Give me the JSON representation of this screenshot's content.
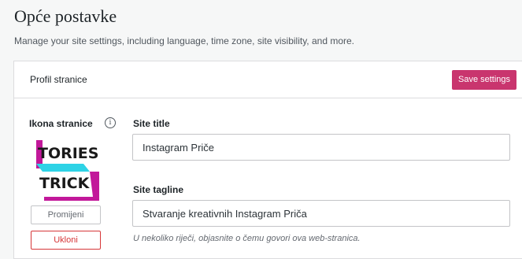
{
  "header": {
    "title": "Opće postavke",
    "subtitle": "Manage your site settings, including language, time zone, site visibility, and more."
  },
  "card": {
    "title": "Profil stranice",
    "save_label": "Save settings"
  },
  "site_icon": {
    "label": "Ikona stranice",
    "info_icon": "info-icon",
    "info_glyph": "i",
    "logo_text": [
      "TORIES",
      "TRICK"
    ],
    "logo_colors": {
      "magenta": "#c2189a",
      "cyan": "#2ed3e6"
    },
    "change_label": "Promijeni",
    "remove_label": "Ukloni"
  },
  "site_title": {
    "label": "Site title",
    "value": "Instagram Priče"
  },
  "site_tagline": {
    "label": "Site tagline",
    "value": "Stvaranje kreativnih Instagram Priča",
    "hint": "U nekoliko riječi, objasnite o čemu govori ova web-stranica."
  },
  "colors": {
    "accent": "#c9356e",
    "danger": "#d63638",
    "border": "#dcdcde",
    "background": "#f6f7f7"
  }
}
